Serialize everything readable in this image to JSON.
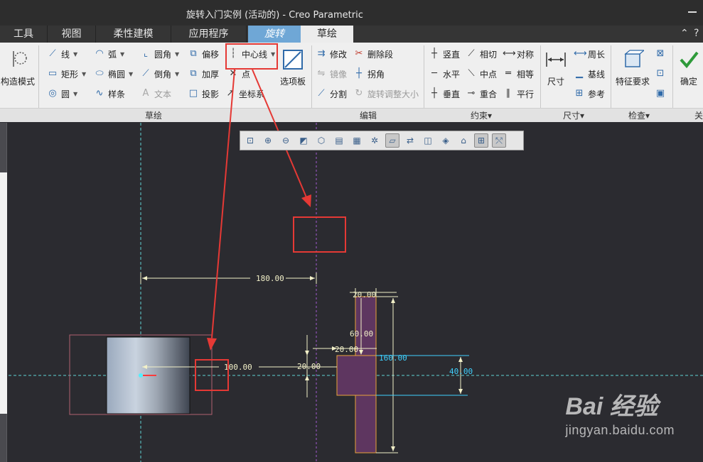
{
  "window": {
    "title": "旋转入门实例 (活动的) - Creo Parametric"
  },
  "tabs": [
    {
      "label": "工具"
    },
    {
      "label": "视图"
    },
    {
      "label": "柔性建模"
    },
    {
      "label": "应用程序"
    },
    {
      "label": "旋转"
    },
    {
      "label": "草绘"
    }
  ],
  "ribbon": {
    "setup": {
      "construction_mode": "构造模式"
    },
    "sketch": {
      "line": "线",
      "arc": "弧",
      "fillet": "圆角",
      "offset": "偏移",
      "centerline": "中心线",
      "rectangle": "矩形",
      "ellipse": "椭圆",
      "chamfer": "倒角",
      "thicken": "加厚",
      "point": "点",
      "circle": "圆",
      "spline": "样条",
      "text": "文本",
      "project": "投影",
      "coord_system": "坐标系",
      "palette": "选项板"
    },
    "editing": {
      "modify": "修改",
      "delete_segment": "删除段",
      "mirror": "镜像",
      "corner": "拐角",
      "divide": "分割",
      "rotate_resize": "旋转调整大小"
    },
    "constrain": {
      "vertical": "竖直",
      "tangent": "相切",
      "symmetric": "对称",
      "horizontal": "水平",
      "midpoint": "中点",
      "equal": "相等",
      "perpendicular": "垂直",
      "coincident": "重合",
      "parallel": "平行"
    },
    "dimension": {
      "normal": "尺寸",
      "perimeter": "周长",
      "baseline": "基线",
      "reference": "参考"
    },
    "inspect": {
      "feature_requirements": "特征要求"
    },
    "close": {
      "ok": "确定",
      "partial": "关"
    },
    "groups": {
      "sketch": "草绘",
      "editing": "编辑",
      "constrain": "约束▾",
      "dimension": "尺寸▾",
      "inspect": "检查▾",
      "close": "关"
    }
  },
  "dimensions": {
    "d180": "180.00",
    "d100": "100.00",
    "d20_left": "20.00",
    "d20_top": "20.00",
    "d60": "60.00",
    "d20_mid": "20.00",
    "d160": "160.00",
    "d40": "40.00"
  },
  "watermark": {
    "logo": "Bai  经验",
    "url": "jingyan.baidu.com"
  },
  "colors": {
    "sketch_fill": "#5e3660",
    "sketch_edge": "#e8a33a",
    "dimension": "#f2f0c8",
    "strong_dimension": "#3fd1ff",
    "centerline": "#5fd3d3",
    "annotation": "#e53935",
    "active_tab": "#6fa7d6"
  }
}
